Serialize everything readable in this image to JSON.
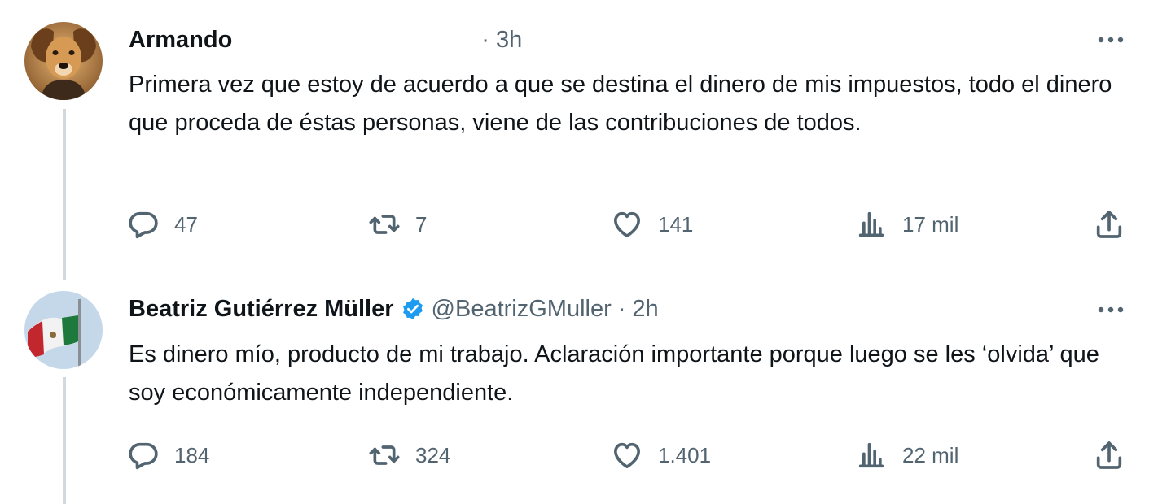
{
  "tweets": [
    {
      "display_name": "Armando",
      "handle": "",
      "separator": "·",
      "time": "3h",
      "verified": false,
      "text": "Primera vez que estoy de acuerdo a que se destina el dinero de mis impuestos, todo el dinero que proceda de éstas personas, viene de las contribuciones de todos.",
      "replies": "47",
      "retweets": "7",
      "likes": "141",
      "views": "17 mil",
      "avatar_icon": "dog-avatar"
    },
    {
      "display_name": "Beatriz Gutiérrez Müller",
      "handle": "@BeatrizGMuller",
      "separator": "·",
      "time": "2h",
      "verified": true,
      "text": "Es dinero mío, producto de mi trabajo. Aclaración importante porque luego se les ‘olvida’ que soy económicamente independiente.",
      "replies": "184",
      "retweets": "324",
      "likes": "1.401",
      "views": "22 mil",
      "avatar_icon": "mexican-flag-avatar"
    }
  ],
  "colors": {
    "text": "#0f1419",
    "secondary": "#536471",
    "verified": "#1d9bf0",
    "thread_line": "#cfd9de"
  },
  "icons": [
    "reply-icon",
    "retweet-icon",
    "like-icon",
    "views-icon",
    "share-icon",
    "more-icon",
    "verified-badge-icon"
  ]
}
